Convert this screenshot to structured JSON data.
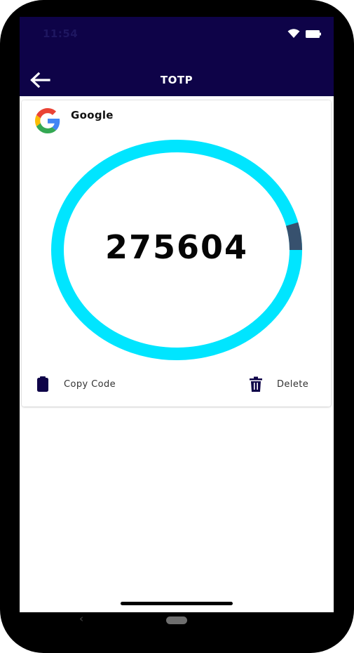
{
  "status_bar": {
    "time": "11:54",
    "icons": [
      "wifi-icon",
      "battery-icon"
    ]
  },
  "app_bar": {
    "title": "TOTP",
    "back_icon": "arrow-left-icon"
  },
  "account": {
    "issuer": "Google",
    "logo_icon": "google-logo-icon",
    "code": "275604",
    "time_remaining_fraction": 0.96,
    "ring_color": "#00e5ff",
    "ring_elapsed_color": "#37516e",
    "actions": {
      "copy_label": "Copy Code",
      "copy_icon": "clipboard-icon",
      "delete_label": "Delete",
      "delete_icon": "trash-icon"
    }
  },
  "colors": {
    "app_bar_bg": "#0e0348",
    "icon_color": "#0e0348"
  },
  "system_nav": {
    "back_glyph": "‹"
  }
}
